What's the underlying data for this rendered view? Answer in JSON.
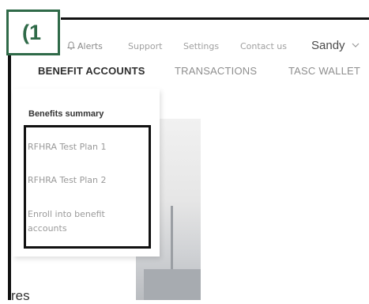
{
  "step_badge": "(1",
  "header": {
    "alerts": "Alerts",
    "support": "Support",
    "settings": "Settings",
    "contact": "Contact us",
    "user_name": "Sandy"
  },
  "nav": {
    "tabs": [
      {
        "label": "BENEFIT ACCOUNTS"
      },
      {
        "label": "TRANSACTIONS"
      },
      {
        "label": "TASC WALLET"
      }
    ]
  },
  "dropdown": {
    "heading": "Benefits summary",
    "items": [
      {
        "label": "RFHRA Test Plan 1"
      },
      {
        "label": "RFHRA Test Plan 2"
      },
      {
        "label": "Enroll into benefit accounts"
      }
    ]
  },
  "partial_text": "res",
  "colors": {
    "badge_green": "#2f6a48",
    "frame": "#111111",
    "muted_text": "#9a9a9a"
  },
  "icons": {
    "alerts": "bell-icon",
    "user_menu": "chevron-down-icon"
  }
}
